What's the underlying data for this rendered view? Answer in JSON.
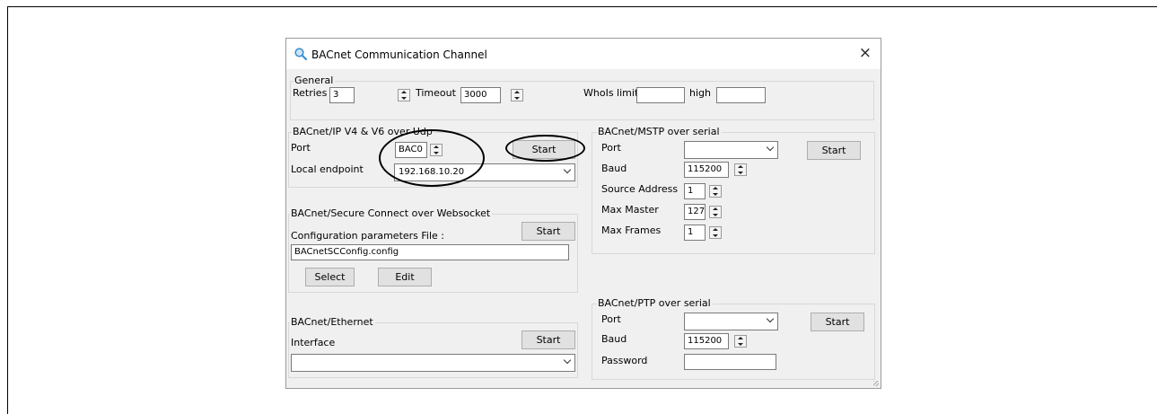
{
  "window": {
    "title": "BACnet Communication Channel",
    "close_icon": "×"
  },
  "general": {
    "legend": "General",
    "retries_label": "Retries",
    "retries_value": "3",
    "timeout_label": "Timeout",
    "timeout_value": "3000",
    "whois_low_label": "WhoIs limit low",
    "whois_low_value": "",
    "whois_high_label": "high",
    "whois_high_value": ""
  },
  "ip": {
    "legend": "BACnet/IP V4 & V6 over Udp",
    "port_label": "Port",
    "port_value": "BAC0",
    "start_label": "Start",
    "endpoint_label": "Local endpoint",
    "endpoint_value": "192.168.10.20"
  },
  "sc": {
    "legend": "BACnet/Secure Connect over Websocket",
    "config_label": "Configuration parameters File :",
    "start_label": "Start",
    "file_value": "BACnetSCConfig.config",
    "select_label": "Select",
    "edit_label": "Edit"
  },
  "ethernet": {
    "legend": "BACnet/Ethernet",
    "interface_label": "Interface",
    "start_label": "Start",
    "interface_value": ""
  },
  "mstp": {
    "legend": "BACnet/MSTP over serial",
    "port_label": "Port",
    "port_value": "",
    "start_label": "Start",
    "baud_label": "Baud",
    "baud_value": "115200",
    "source_label": "Source Address",
    "source_value": "1",
    "maxmaster_label": "Max Master",
    "maxmaster_value": "127",
    "maxframes_label": "Max Frames",
    "maxframes_value": "1"
  },
  "ptp": {
    "legend": "BACnet/PTP over serial",
    "port_label": "Port",
    "port_value": "",
    "start_label": "Start",
    "baud_label": "Baud",
    "baud_value": "115200",
    "password_label": "Password",
    "password_value": ""
  }
}
